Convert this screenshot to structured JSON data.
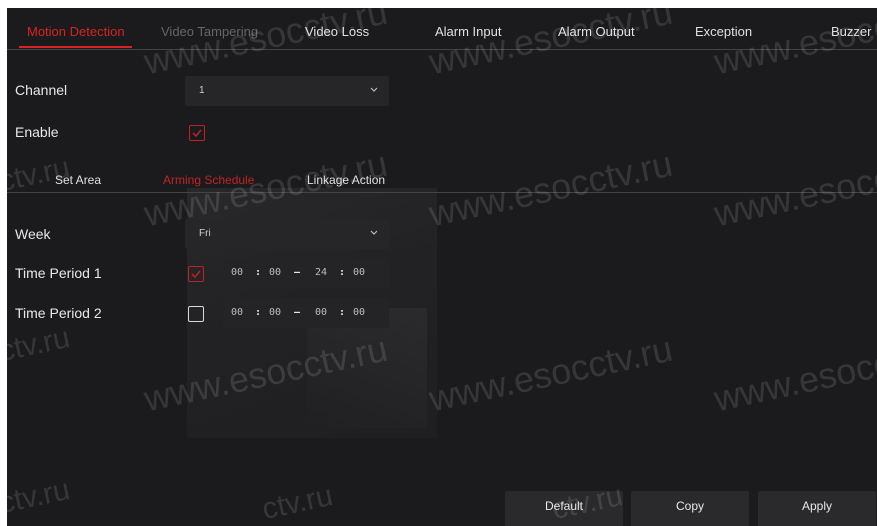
{
  "tabs": [
    {
      "label": "Motion Detection",
      "state": "active"
    },
    {
      "label": "Video Tampering",
      "state": "disabled"
    },
    {
      "label": "Video Loss",
      "state": "normal"
    },
    {
      "label": "Alarm Input",
      "state": "normal"
    },
    {
      "label": "Alarm Output",
      "state": "normal"
    },
    {
      "label": "Exception",
      "state": "normal"
    },
    {
      "label": "Buzzer",
      "state": "normal"
    }
  ],
  "channel": {
    "label": "Channel",
    "value": "1"
  },
  "enable": {
    "label": "Enable",
    "checked": true
  },
  "subtabs": [
    {
      "label": "Set Area",
      "state": "normal"
    },
    {
      "label": "Arming Schedule",
      "state": "active"
    },
    {
      "label": "Linkage Action",
      "state": "normal"
    }
  ],
  "week": {
    "label": "Week",
    "value": "Fri"
  },
  "period1": {
    "label": "Time Period 1",
    "checked": true,
    "start_h": "00",
    "start_m": "00",
    "end_h": "24",
    "end_m": "00",
    "colon": ":",
    "dash": "–"
  },
  "period2": {
    "label": "Time Period 2",
    "checked": false,
    "start_h": "00",
    "start_m": "00",
    "end_h": "00",
    "end_m": "00",
    "colon": ":",
    "dash": "–"
  },
  "buttons": {
    "default": "Default",
    "copy": "Copy",
    "apply": "Apply"
  },
  "watermark": "www.esocctv.ru",
  "watermark_short": "ctv.ru",
  "colors": {
    "accent": "#d62424",
    "panel": "#1b1b1d",
    "field": "#262628"
  }
}
